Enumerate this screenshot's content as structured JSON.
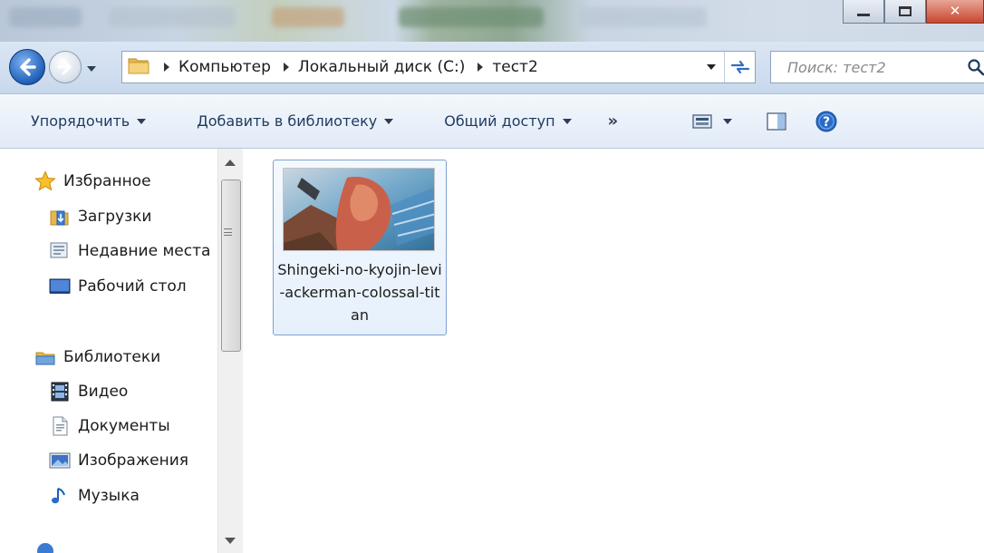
{
  "breadcrumb": [
    "Компьютер",
    "Локальный диск (C:)",
    "тест2"
  ],
  "search": {
    "placeholder": "Поиск: тест2"
  },
  "toolbar": {
    "organize": "Упорядочить",
    "add_to_library": "Добавить в библиотеку",
    "share": "Общий доступ",
    "more": "»"
  },
  "sidebar": {
    "favorites": {
      "header": "Избранное",
      "items": [
        "Загрузки",
        "Недавние места",
        "Рабочий стол"
      ]
    },
    "libraries": {
      "header": "Библиотеки",
      "items": [
        "Видео",
        "Документы",
        "Изображения",
        "Музыка"
      ]
    }
  },
  "files": [
    {
      "name": "Shingeki-no-kyojin-levi-ackerman-colossal-titan"
    }
  ],
  "colors": {
    "accent": "#1f5fb8",
    "selection_border": "#7da2ce",
    "close_button": "#c8462f"
  }
}
